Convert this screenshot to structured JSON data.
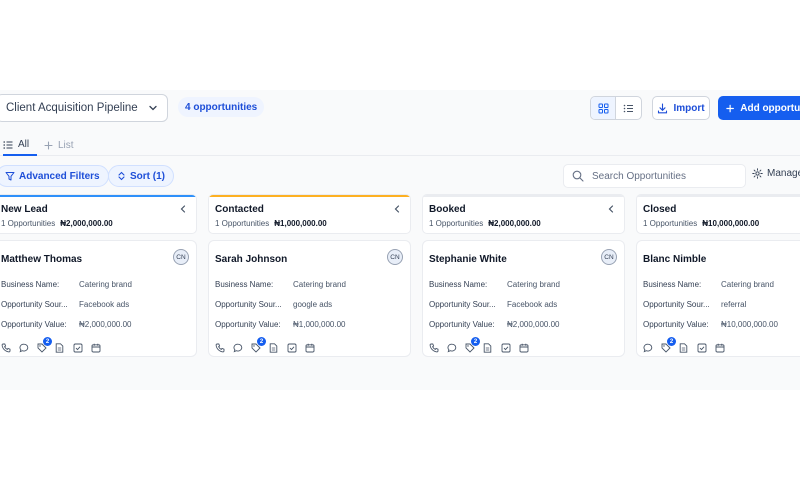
{
  "header": {
    "pipeline_name": "Client Acquisition Pipeline",
    "opportunity_count": "4 opportunities",
    "import_label": "Import",
    "add_label": "Add opportunity"
  },
  "tabs": [
    {
      "label": "All",
      "icon": "list-icon"
    },
    {
      "label": "List",
      "icon": "plus-icon"
    }
  ],
  "filters": {
    "advanced_label": "Advanced Filters",
    "sort_label": "Sort (1)",
    "search_placeholder": "Search Opportunities",
    "manage_label": "Manage"
  },
  "field_labels": {
    "business_name": "Business Name:",
    "opportunity_source": "Opportunity Sour...",
    "opportunity_value": "Opportunity Value:"
  },
  "columns": [
    {
      "title": "New Lead",
      "count": "1 Opportunities",
      "total": "₦2,000,000.00",
      "accent": "#2e90fa",
      "card": {
        "name": "Matthew Thomas",
        "avatar": "CN",
        "business_name": "Catering brand",
        "source": "Facebook ads",
        "value": "₦2,000,000.00",
        "badge": "2"
      }
    },
    {
      "title": "Contacted",
      "count": "1 Opportunities",
      "total": "₦1,000,000.00",
      "accent": "#fdb022",
      "card": {
        "name": "Sarah Johnson",
        "avatar": "CN",
        "business_name": "Catering brand",
        "source": "google ads",
        "value": "₦1,000,000.00",
        "badge": "2"
      }
    },
    {
      "title": "Booked",
      "count": "1 Opportunities",
      "total": "₦2,000,000.00",
      "accent": "#eaecf0",
      "card": {
        "name": "Stephanie White",
        "avatar": "CN",
        "business_name": "Catering brand",
        "source": "Facebook ads",
        "value": "₦2,000,000.00",
        "badge": "2"
      }
    },
    {
      "title": "Closed",
      "count": "1 Opportunities",
      "total": "₦10,000,000.00",
      "accent": "#eaecf0",
      "card": {
        "name": "Blanc Nimble",
        "avatar": "",
        "business_name": "Catering brand",
        "source": "referral",
        "value": "₦10,000,000.00",
        "badge": "2"
      }
    }
  ]
}
